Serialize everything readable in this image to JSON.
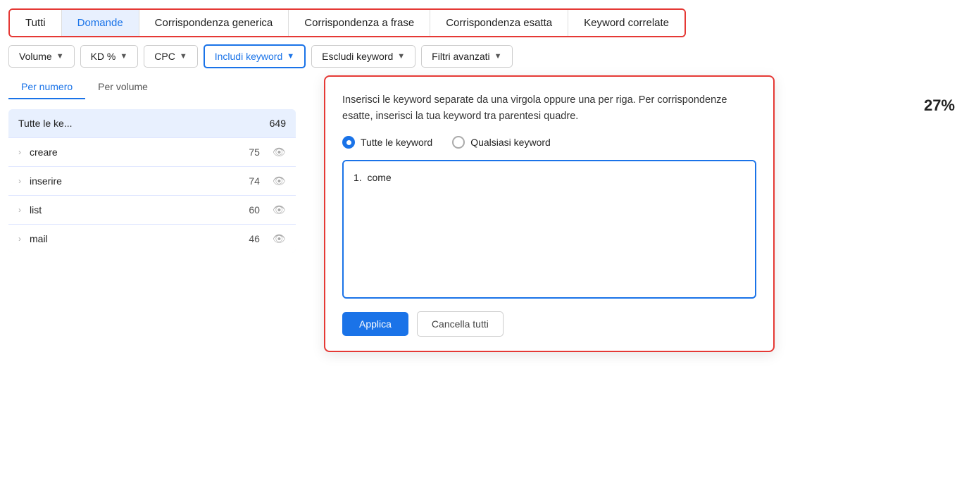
{
  "tabs": {
    "items": [
      {
        "id": "tutti",
        "label": "Tutti",
        "active": false
      },
      {
        "id": "domande",
        "label": "Domande",
        "active": true
      },
      {
        "id": "generica",
        "label": "Corrispondenza generica",
        "active": false
      },
      {
        "id": "frase",
        "label": "Corrispondenza a frase",
        "active": false
      },
      {
        "id": "esatta",
        "label": "Corrispondenza esatta",
        "active": false
      },
      {
        "id": "correlate",
        "label": "Keyword correlate",
        "active": false
      }
    ]
  },
  "filters": {
    "volume": {
      "label": "Volume"
    },
    "kd": {
      "label": "KD %"
    },
    "cpc": {
      "label": "CPC"
    },
    "includi": {
      "label": "Includi keyword"
    },
    "escludi": {
      "label": "Escludi keyword"
    },
    "avanzati": {
      "label": "Filtri avanzati"
    }
  },
  "subtabs": [
    {
      "label": "Per numero",
      "active": true
    },
    {
      "label": "Per volume",
      "active": false
    }
  ],
  "keyword_list": {
    "header": {
      "label": "Tutte le ke...",
      "count": "649"
    },
    "items": [
      {
        "name": "creare",
        "count": "75"
      },
      {
        "name": "inserire",
        "count": "74"
      },
      {
        "name": "list",
        "count": "60"
      },
      {
        "name": "mail",
        "count": "46"
      }
    ]
  },
  "dropdown": {
    "description": "Inserisci le keyword separate da una virgola oppure una per riga. Per corrispondenze esatte, inserisci la tua keyword tra parentesi quadre.",
    "radio_options": [
      {
        "label": "Tutte le keyword",
        "selected": true
      },
      {
        "label": "Qualsiasi keyword",
        "selected": false
      }
    ],
    "textarea_placeholder": "1.  come",
    "textarea_value": "1.  come",
    "btn_apply": "Applica",
    "btn_cancel": "Cancella tutti"
  },
  "right_pct": "27%"
}
